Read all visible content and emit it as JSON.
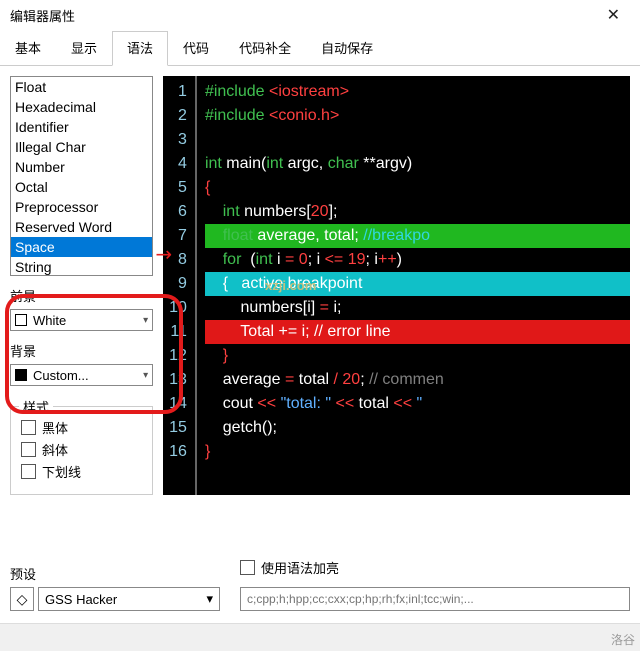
{
  "window": {
    "title": "编辑器属性"
  },
  "tabs": [
    "基本",
    "显示",
    "语法",
    "代码",
    "代码补全",
    "自动保存"
  ],
  "active_tab": 2,
  "token_list": [
    "Float",
    "Hexadecimal",
    "Identifier",
    "Illegal Char",
    "Number",
    "Octal",
    "Preprocessor",
    "Reserved Word",
    "Space",
    "String"
  ],
  "token_selected": "Space",
  "foreground": {
    "label": "前景",
    "value": "White",
    "swatch": "#ffffff"
  },
  "background": {
    "label": "背景",
    "value": "Custom...",
    "swatch": "#000000"
  },
  "style_group": {
    "title": "样式",
    "bold": "黑体",
    "italic": "斜体",
    "underline": "下划线"
  },
  "preset": {
    "label": "预设",
    "value": "GSS Hacker"
  },
  "syntax_highlight_label": "使用语法加亮",
  "extensions_placeholder": "c;cpp;h;hpp;cc;cxx;cp;hp;rh;fx;inl;tcc;win;...",
  "watermark": "洛谷",
  "wm2": "xzji.com",
  "code": {
    "lines": [
      {
        "n": 1,
        "t": [
          [
            "kw-green",
            "#include "
          ],
          [
            "kw-red",
            "<iostream>"
          ]
        ]
      },
      {
        "n": 2,
        "t": [
          [
            "kw-green",
            "#include "
          ],
          [
            "kw-red",
            "<conio.h>"
          ]
        ]
      },
      {
        "n": 3,
        "t": []
      },
      {
        "n": 4,
        "t": [
          [
            "kw-green",
            "int"
          ],
          [
            "kw-white",
            " main"
          ],
          [
            "kw-white",
            "("
          ],
          [
            "kw-green",
            "int"
          ],
          [
            "kw-white",
            " argc"
          ],
          [
            "kw-white",
            ", "
          ],
          [
            "kw-green",
            "char"
          ],
          [
            "kw-white",
            " **argv"
          ],
          [
            "kw-white",
            ")"
          ]
        ]
      },
      {
        "n": 5,
        "t": [
          [
            "kw-red",
            "{"
          ]
        ],
        "fold": true
      },
      {
        "n": 6,
        "t": [
          [
            "kw-white",
            "    "
          ],
          [
            "kw-green",
            "int"
          ],
          [
            "kw-white",
            " numbers["
          ],
          [
            "kw-red",
            "20"
          ],
          [
            "kw-white",
            "];"
          ]
        ]
      },
      {
        "n": 7,
        "bg": "hl-green",
        "t": [
          [
            "kw-white",
            "    "
          ],
          [
            "kw-green",
            "float"
          ],
          [
            "kw-white",
            " average, total; "
          ],
          [
            "kw-cyan",
            "//breakpo"
          ]
        ]
      },
      {
        "n": 8,
        "t": [
          [
            "kw-white",
            "    "
          ],
          [
            "kw-green",
            "for  "
          ],
          [
            "kw-white",
            "("
          ],
          [
            "kw-green",
            "int"
          ],
          [
            "kw-white",
            " i "
          ],
          [
            "kw-red",
            "="
          ],
          [
            "kw-white",
            " "
          ],
          [
            "kw-red",
            "0"
          ],
          [
            "kw-white",
            "; i "
          ],
          [
            "kw-red",
            "<="
          ],
          [
            "kw-white",
            " "
          ],
          [
            "kw-red",
            "19"
          ],
          [
            "kw-white",
            "; i"
          ],
          [
            "kw-red",
            "++"
          ],
          [
            "kw-white",
            ")"
          ]
        ]
      },
      {
        "n": 9,
        "bg": "hl-cyan",
        "t": [
          [
            "kw-white",
            "    {   "
          ],
          [
            "kw-white",
            "active breakpoint"
          ]
        ],
        "fold": true
      },
      {
        "n": 10,
        "t": [
          [
            "kw-white",
            "        numbers[i] "
          ],
          [
            "kw-red",
            "="
          ],
          [
            "kw-white",
            " i;"
          ]
        ]
      },
      {
        "n": 11,
        "bg": "hl-red",
        "t": [
          [
            "kw-white",
            "        Total += i; // error line"
          ]
        ]
      },
      {
        "n": 12,
        "t": [
          [
            "kw-red",
            "    }"
          ]
        ]
      },
      {
        "n": 13,
        "t": [
          [
            "kw-white",
            "    average "
          ],
          [
            "kw-red",
            "="
          ],
          [
            "kw-white",
            " total "
          ],
          [
            "kw-red",
            "/"
          ],
          [
            "kw-white",
            " "
          ],
          [
            "kw-red",
            "20"
          ],
          [
            "kw-white",
            "; "
          ],
          [
            "kw-grey",
            "// commen"
          ]
        ]
      },
      {
        "n": 14,
        "t": [
          [
            "kw-white",
            "    cout "
          ],
          [
            "kw-red",
            "<<"
          ],
          [
            "kw-white",
            " "
          ],
          [
            "kw-str",
            "\"total: \""
          ],
          [
            "kw-white",
            " "
          ],
          [
            "kw-red",
            "<<"
          ],
          [
            "kw-white",
            " total "
          ],
          [
            "kw-red",
            "<<"
          ],
          [
            "kw-white",
            " "
          ],
          [
            "kw-str",
            "\""
          ]
        ]
      },
      {
        "n": 15,
        "t": [
          [
            "kw-white",
            "    getch"
          ],
          [
            "kw-white",
            "();"
          ]
        ]
      },
      {
        "n": 16,
        "t": [
          [
            "kw-red",
            "}"
          ]
        ]
      }
    ]
  }
}
